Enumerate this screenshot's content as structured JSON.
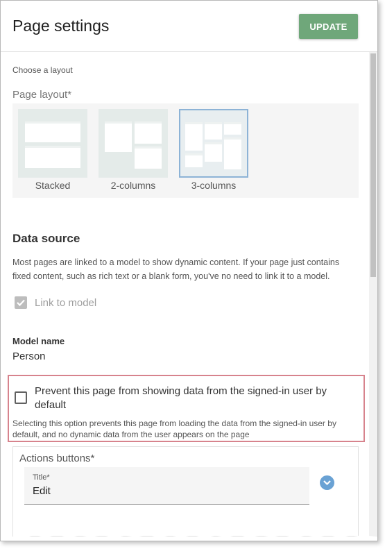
{
  "header": {
    "title": "Page settings",
    "update_label": "UPDATE"
  },
  "layout": {
    "hint": "Choose a layout",
    "label": "Page layout*",
    "options": [
      {
        "label": "Stacked",
        "selected": false
      },
      {
        "label": "2-columns",
        "selected": false
      },
      {
        "label": "3-columns",
        "selected": true
      }
    ]
  },
  "data_source": {
    "title": "Data source",
    "description": "Most pages are linked to a model to show dynamic content. If your page just contains fixed content, such as rich text or a blank form, you've no need to link it to a model.",
    "link_label": "Link to model",
    "link_checked": true
  },
  "model": {
    "title": "Model name",
    "value": "Person"
  },
  "prevent": {
    "label": "Prevent this page from showing data from the signed-in user by default",
    "checked": false,
    "description": "Selecting this option prevents this page from loading the data from the signed-in user by default, and no dynamic data from the user appears on the page"
  },
  "actions": {
    "title": "Actions buttons*",
    "field_label": "Title*",
    "field_value": "Edit"
  },
  "colors": {
    "update_button": "#6fa77a",
    "highlight": "#d7838d",
    "expand": "#6aa2d4"
  }
}
